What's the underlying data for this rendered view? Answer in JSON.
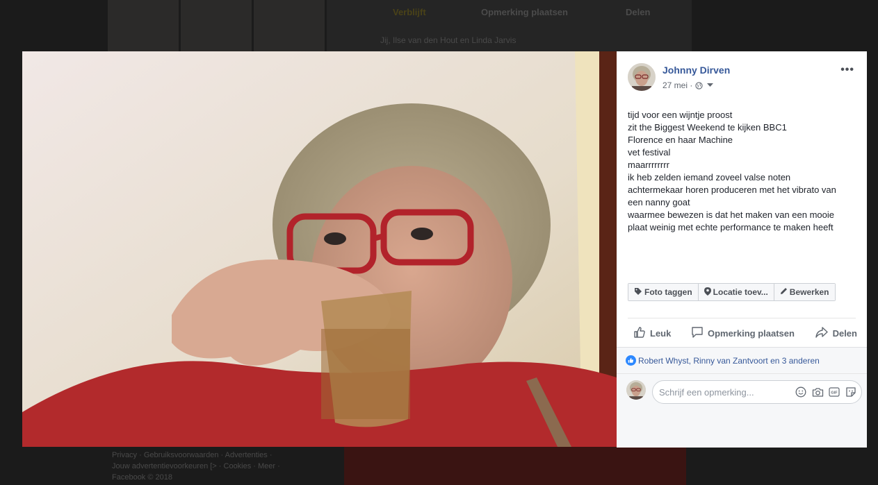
{
  "background": {
    "actions": [
      "Verblijft",
      "Opmerking plaatsen",
      "Delen"
    ],
    "reactions_text": "Jij, Ilse van den Hout en Linda Jarvis",
    "footer_line1": "Privacy · Gebruiksvoorwaarden · Advertenties ·",
    "footer_line2": "Jouw advertentievoorkeuren [> · Cookies · Meer ·",
    "footer_line3": "Facebook © 2018"
  },
  "post": {
    "author": "Johnny Dirven",
    "date": "27 mei",
    "lines": [
      "tijd voor een wijntje proost",
      "zit the Biggest Weekend te kijken BBC1",
      "Florence en haar Machine",
      "vet festival",
      "maarrrrrrrr",
      "ik heb zelden iemand zoveel valse noten",
      "achtermekaar horen produceren met het vibrato van",
      "een nanny goat",
      "waarmee bewezen is dat het maken van een mooie",
      "plaat weinig met echte performance te maken heeft"
    ],
    "tag_buttons": [
      "Foto taggen",
      "Locatie toev...",
      "Bewerken"
    ],
    "actions": {
      "like": "Leuk",
      "comment": "Opmerking plaatsen",
      "share": "Delen"
    },
    "likes_text": "Robert Whyst, Rinny van Zantvoort en 3 anderen",
    "comment_placeholder": "Schrijf een opmerking...",
    "comment_icons": [
      "emoji-icon",
      "camera-icon",
      "gif-icon",
      "sticker-icon"
    ]
  },
  "colors": {
    "link": "#365899",
    "like_blue": "#2d88ff"
  }
}
